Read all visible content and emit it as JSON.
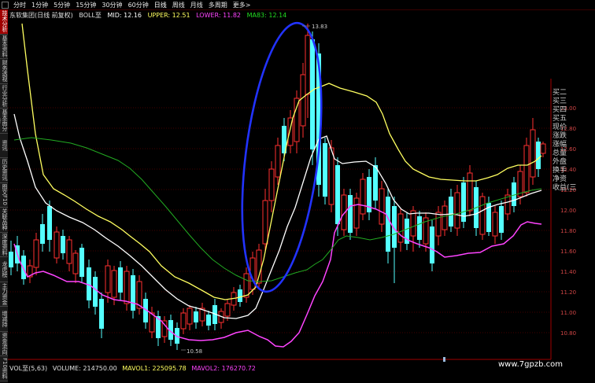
{
  "period_tabs": [
    "分时",
    "1分钟",
    "5分钟",
    "15分钟",
    "30分钟",
    "60分钟",
    "日线",
    "周线",
    "月线",
    "多周期",
    "更多>"
  ],
  "left_tabs": [
    "技术分析",
    "基本资料",
    "财务透视",
    "行业分析",
    "基本面分析",
    "资讯",
    "历史资讯",
    "图文F10",
    "关联品种",
    "深度资料",
    "龙虎榜",
    "主力资金",
    "增减持",
    "资金流向",
    "F10资料"
  ],
  "info": {
    "stock_name": "东软集团(日线 前复权)",
    "indicator": "BOLL至",
    "mid": "MID: 12.16",
    "upper": "UPPER: 12.51",
    "lower": "LOWER: 11.82",
    "ma": "MA83: 12.14"
  },
  "price_axis": [
    "13.00",
    "12.80",
    "12.60",
    "12.40",
    "12.20",
    "12.00",
    "11.80",
    "11.60",
    "11.40",
    "11.20",
    "11.00",
    "10.80"
  ],
  "annotations": {
    "high": "13.83",
    "low": "10.58"
  },
  "quote_panel": [
    "买二",
    "买三",
    "买四",
    "买五",
    "现价",
    "涨跌",
    "涨幅",
    "总量",
    "外盘",
    "换手",
    "净资",
    "收益(三"
  ],
  "volume_bar": {
    "indicator": "VOL至(5,63)",
    "volume": "VOLUME: 214750.00",
    "mavol1": "MAVOL1: 225095.78",
    "mavol2": "MAVOL2: 176270.72"
  },
  "watermark": "www.7gpzb.com",
  "colors": {
    "up": "#ff3030",
    "down": "#54ffff",
    "upper": "#ffff60",
    "mid": "#ffffff",
    "lower": "#ff44ff",
    "ma": "#22aa22",
    "circle": "#2233ff"
  }
}
